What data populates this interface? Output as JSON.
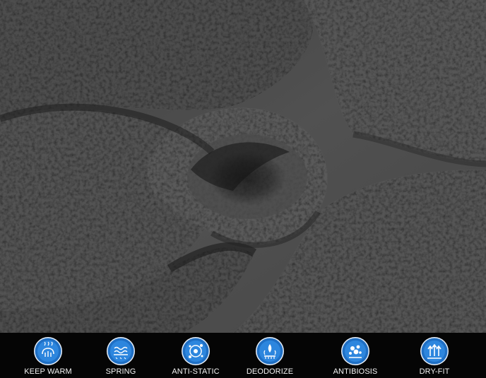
{
  "features": [
    {
      "label": "KEEP WARM",
      "icon": "keep-warm-icon"
    },
    {
      "label": "SPRING",
      "icon": "spring-icon"
    },
    {
      "label": "ANTI-STATIC",
      "icon": "anti-static-icon"
    },
    {
      "label": "DEODORIZE",
      "icon": "deodorize-icon"
    },
    {
      "label": "ANTIBIOSIS",
      "icon": "antibiosis-icon"
    },
    {
      "label": "DRY-FIT",
      "icon": "dry-fit-icon"
    }
  ],
  "colors": {
    "fabric": "#4a4a4a",
    "badge_outer": "#1f6fc4",
    "badge_inner": "#2d86de",
    "strip": "#050505"
  }
}
